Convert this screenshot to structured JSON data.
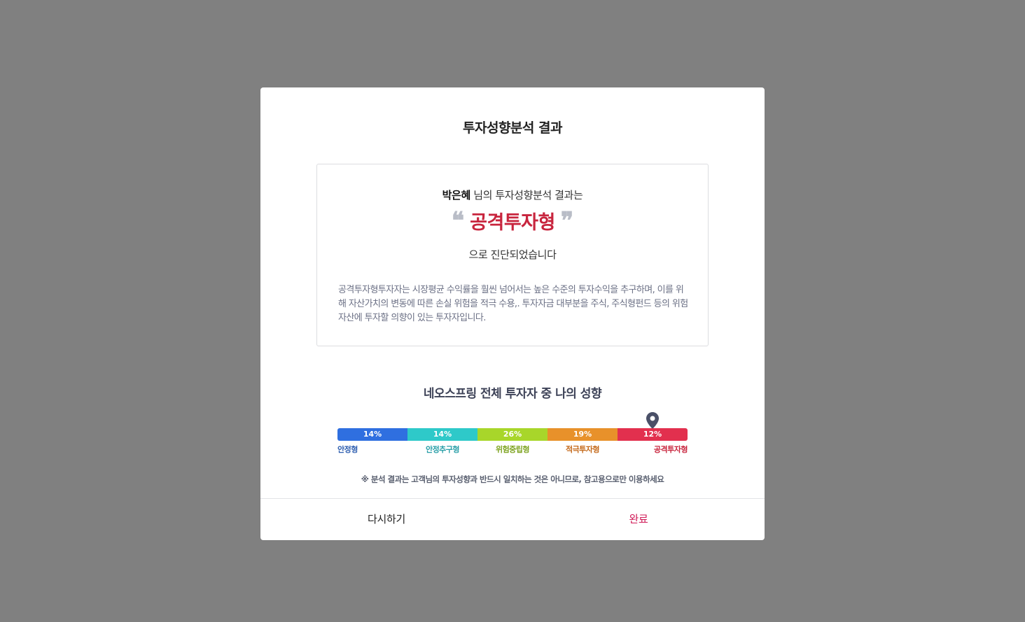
{
  "modal": {
    "title": "투자성향분석 결과",
    "result": {
      "user_name": "박은혜",
      "line1_suffix": " 님의 투자성향분석 결과는",
      "open_quote": "❝",
      "type": "공격투자형",
      "close_quote": "❞",
      "line3": "으로 진단되었습니다",
      "description": "공격투자형투자자는 시장평균 수익률을 훨씬 넘어서는 높은 수준의 투자수익을 추구하며, 이를 위해 자산가치의 변동에 따른 손실 위험을 적극 수용,. 투자자금 대부분을 주식, 주식형펀드 등의 위험자산에 투자할 의향이 있는 투자자입니다."
    },
    "distribution": {
      "title": "네오스프링 전체 투자자 중 나의 성향",
      "current_index": 4,
      "segments": [
        {
          "percent": "14%",
          "label": "안정형",
          "color": "#2f6fe0",
          "label_color": "#2f5fb0"
        },
        {
          "percent": "14%",
          "label": "안정추구형",
          "color": "#2ec9c9",
          "label_color": "#2a9fa8"
        },
        {
          "percent": "26%",
          "label": "위험중립형",
          "color": "#a8d62a",
          "label_color": "#7da31f"
        },
        {
          "percent": "19%",
          "label": "적극투자형",
          "color": "#e8912a",
          "label_color": "#c4691a"
        },
        {
          "percent": "12%",
          "label": "공격투자형",
          "color": "#e2304e",
          "label_color": "#c8253e"
        }
      ]
    },
    "notice": "※ 분석 결과는 고객님의 투자성향과 반드시 일치하는 것은 아니므로, 참고용으로만 이용하세요",
    "buttons": {
      "retry": "다시하기",
      "done": "완료"
    },
    "colors": {
      "accent": "#c8253e",
      "done_button": "#d01a57",
      "pin": "#4a5068"
    }
  }
}
